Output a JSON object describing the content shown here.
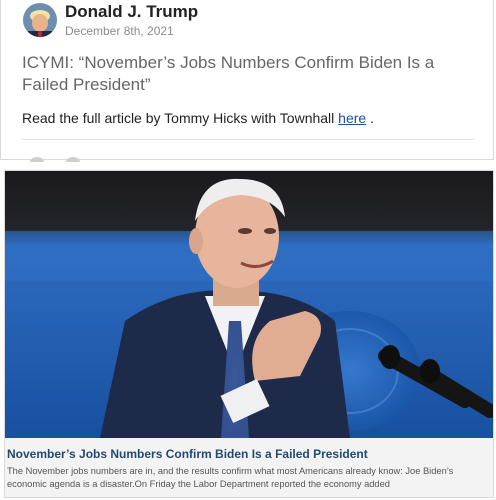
{
  "post": {
    "author_name": "Donald J. Trump",
    "date": "December 8th, 2021",
    "title": "ICYMI: “November’s Jobs Numbers Confirm Biden Is a Failed President”",
    "body_prefix": "Read the full article by Tommy Hicks with Townhall ",
    "link_text": "here",
    "body_suffix": " ."
  },
  "preview": {
    "title": "November’s Jobs Numbers Confirm Biden Is a Failed President",
    "description": "The November jobs numbers are in, and the results confirm what most Americans already know: Joe Biden’s economic agenda is a disaster.On Friday the Labor Department reported the economy added"
  },
  "colors": {
    "link": "#1a4fa3",
    "preview_title": "#24496f",
    "photo_background": "#1f5fb0"
  }
}
